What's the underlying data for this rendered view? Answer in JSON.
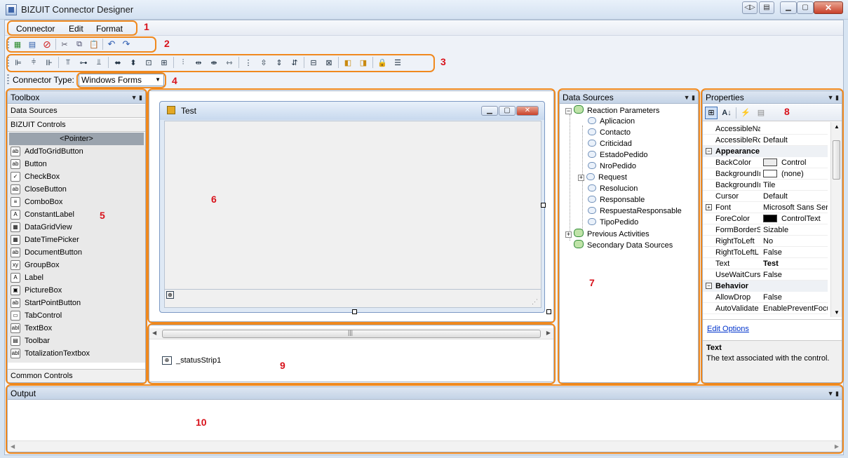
{
  "window": {
    "title": "BIZUIT Connector Designer"
  },
  "menu": {
    "connector": "Connector",
    "edit": "Edit",
    "format": "Format"
  },
  "connector_type": {
    "label": "Connector Type:",
    "value": "Windows Forms"
  },
  "toolbox": {
    "title": "Toolbox",
    "tab_data_sources": "Data Sources",
    "tab_bizuit_controls": "BIZUIT Controls",
    "tab_common_controls": "Common Controls",
    "items": [
      {
        "label": "<Pointer>",
        "icon": ""
      },
      {
        "label": "AddToGridButton",
        "icon": "ab"
      },
      {
        "label": "Button",
        "icon": "ab"
      },
      {
        "label": "CheckBox",
        "icon": "✓"
      },
      {
        "label": "CloseButton",
        "icon": "ab"
      },
      {
        "label": "ComboBox",
        "icon": "≡"
      },
      {
        "label": "ConstantLabel",
        "icon": "A"
      },
      {
        "label": "DataGridView",
        "icon": "▦"
      },
      {
        "label": "DateTimePicker",
        "icon": "▦"
      },
      {
        "label": "DocumentButton",
        "icon": "ab"
      },
      {
        "label": "GroupBox",
        "icon": "xy"
      },
      {
        "label": "Label",
        "icon": "A"
      },
      {
        "label": "PictureBox",
        "icon": "▣"
      },
      {
        "label": "StartPointButton",
        "icon": "ab"
      },
      {
        "label": "TabControl",
        "icon": "▭"
      },
      {
        "label": "TextBox",
        "icon": "abl"
      },
      {
        "label": "Toolbar",
        "icon": "▤"
      },
      {
        "label": "TotalizationTextbox",
        "icon": "abl"
      }
    ]
  },
  "designer": {
    "form_title": "Test",
    "status_strip": "_statusStrip1"
  },
  "data_sources": {
    "title": "Data Sources",
    "root": "Reaction Parameters",
    "children": [
      "Aplicacion",
      "Contacto",
      "Criticidad",
      "EstadoPedido",
      "NroPedido",
      "Request",
      "Resolucion",
      "Responsable",
      "RespuestaResponsable",
      "TipoPedido"
    ],
    "previous": "Previous Activities",
    "secondary": "Secondary Data Sources"
  },
  "properties": {
    "title": "Properties",
    "rows": [
      {
        "name": "AccessibleNa",
        "value": ""
      },
      {
        "name": "AccessibleRc",
        "value": "Default"
      }
    ],
    "appearance_label": "Appearance",
    "appearance": [
      {
        "name": "BackColor",
        "value": "Control",
        "swatch": "#ececec"
      },
      {
        "name": "BackgroundIı",
        "value": "(none)",
        "swatch": "#ffffff"
      },
      {
        "name": "BackgroundIı",
        "value": "Tile"
      },
      {
        "name": "Cursor",
        "value": "Default"
      },
      {
        "name": "Font",
        "value": "Microsoft Sans Serif,"
      },
      {
        "name": "ForeColor",
        "value": "ControlText",
        "swatch": "#000000"
      },
      {
        "name": "FormBorderSt",
        "value": "Sizable"
      },
      {
        "name": "RightToLeft",
        "value": "No"
      },
      {
        "name": "RightToLeftL",
        "value": "False"
      },
      {
        "name": "Text",
        "value": "Test"
      },
      {
        "name": "UseWaitCurs",
        "value": "False"
      }
    ],
    "behavior_label": "Behavior",
    "behavior": [
      {
        "name": "AllowDrop",
        "value": "False"
      },
      {
        "name": "AutoValidate",
        "value": "EnablePreventFocus"
      }
    ],
    "edit_options": "Edit Options",
    "desc_title": "Text",
    "desc_text": "The text associated with the control."
  },
  "output": {
    "title": "Output"
  },
  "annotations": [
    "1",
    "2",
    "3",
    "4",
    "5",
    "6",
    "7",
    "8",
    "9",
    "10"
  ],
  "colors": {
    "highlight": "#f0891e",
    "annotation": "#d8121b"
  }
}
